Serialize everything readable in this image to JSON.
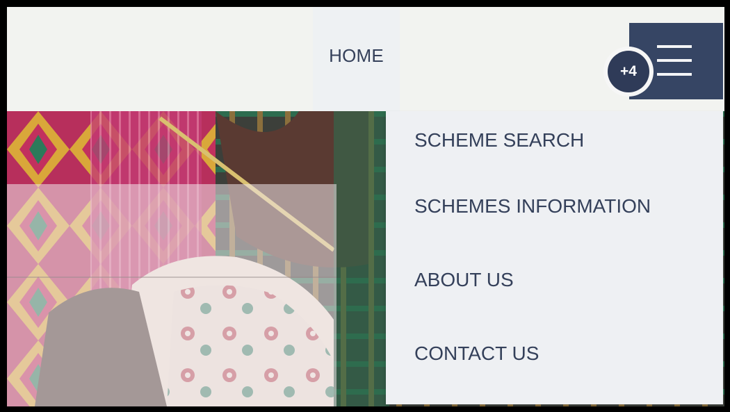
{
  "nav": {
    "home_label": "HOME",
    "menu_icon": "hamburger-menu-icon",
    "hidden_count_label": "+4",
    "items": [
      {
        "label": "SCHEME SEARCH"
      },
      {
        "label": "SCHEMES INFORMATION"
      },
      {
        "label": "ABOUT US"
      },
      {
        "label": "CONTACT US"
      }
    ]
  },
  "colors": {
    "text": "#34405a",
    "menu_button_bg": "#364564",
    "dropdown_bg": "#eef0f3",
    "header_bg": "#f2f3f0"
  }
}
